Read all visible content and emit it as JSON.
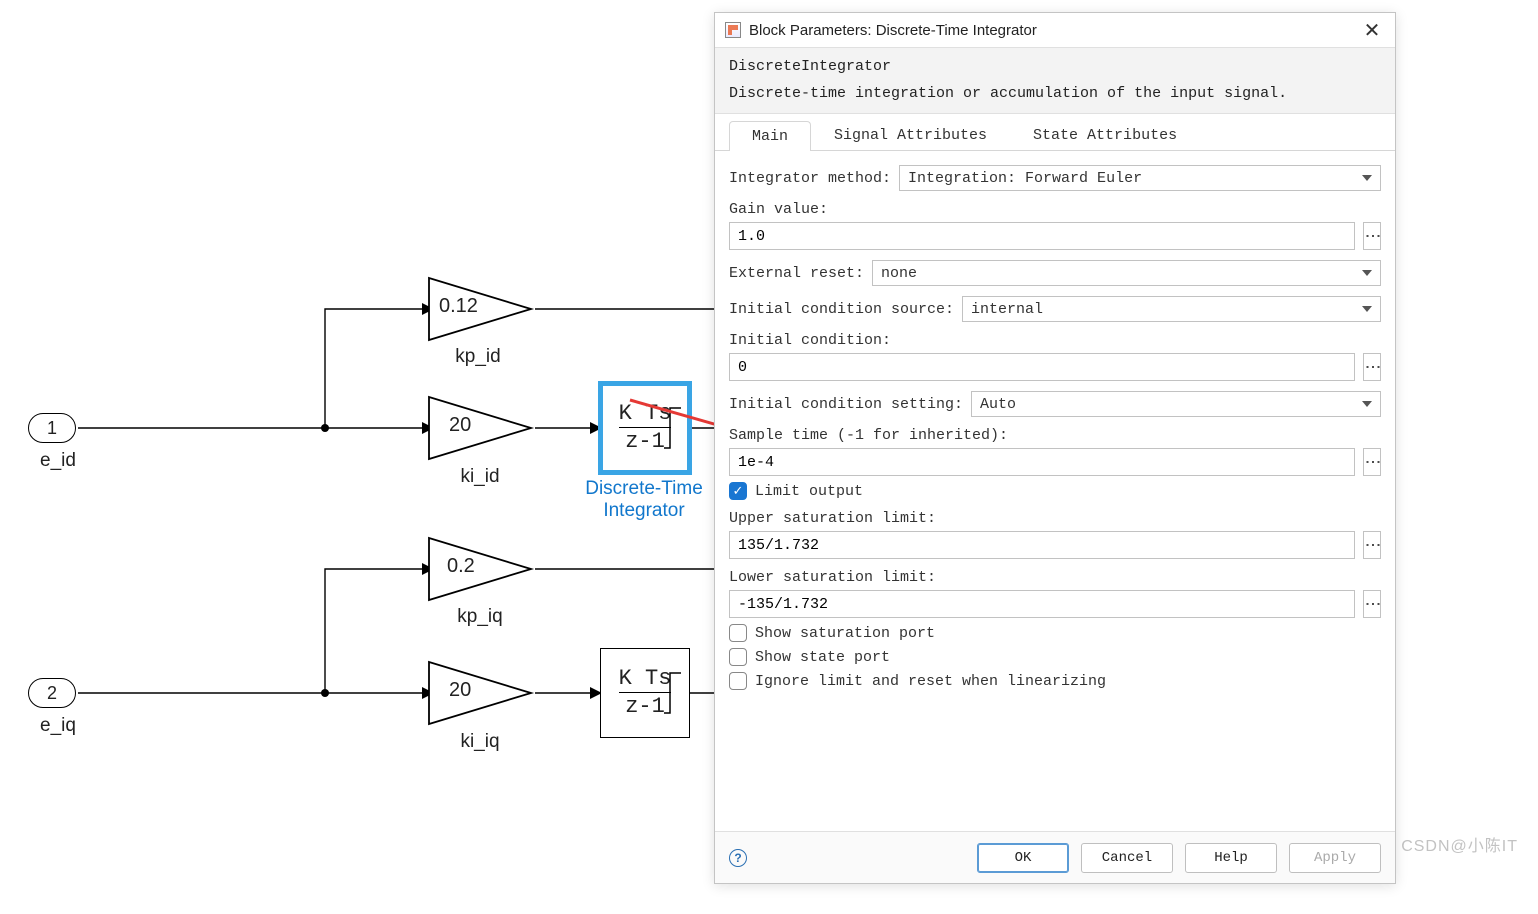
{
  "canvas": {
    "inports": [
      {
        "num": "1",
        "label": "e_id"
      },
      {
        "num": "2",
        "label": "e_iq"
      }
    ],
    "gains": [
      {
        "value": "0.12",
        "label": "kp_id"
      },
      {
        "value": "20",
        "label": "ki_id"
      },
      {
        "value": "0.2",
        "label": "kp_iq"
      },
      {
        "value": "20",
        "label": "ki_iq"
      }
    ],
    "integrators": [
      {
        "num": "K Ts",
        "den": "z-1",
        "label": "Discrete-Time\nIntegrator",
        "selected": true
      },
      {
        "num": "K Ts",
        "den": "z-1",
        "label": "",
        "selected": false
      }
    ]
  },
  "dialog": {
    "title": "Block Parameters: Discrete-Time Integrator",
    "desc_name": "DiscreteIntegrator",
    "desc_text": "Discrete-time integration or accumulation of the input signal.",
    "tabs": [
      "Main",
      "Signal Attributes",
      "State Attributes"
    ],
    "active_tab": 0,
    "labels": {
      "integrator_method": "Integrator method:",
      "gain_value": "Gain value:",
      "external_reset": "External reset:",
      "initial_cond_source": "Initial condition source:",
      "initial_condition": "Initial condition:",
      "initial_cond_setting": "Initial condition setting:",
      "sample_time": "Sample time (-1 for inherited):",
      "limit_output": "Limit output",
      "upper_sat": "Upper saturation limit:",
      "lower_sat": "Lower saturation limit:",
      "show_sat_port": "Show saturation port",
      "show_state_port": "Show state port",
      "ignore_limit": "Ignore limit and reset when linearizing"
    },
    "values": {
      "integrator_method": "Integration: Forward Euler",
      "gain_value": "1.0",
      "external_reset": "none",
      "initial_cond_source": "internal",
      "initial_condition": "0",
      "initial_cond_setting": "Auto",
      "sample_time": "1e-4",
      "upper_sat": "135/1.732",
      "lower_sat": "-135/1.732"
    },
    "checks": {
      "limit_output": true,
      "show_sat_port": false,
      "show_state_port": false,
      "ignore_limit": false
    },
    "buttons": {
      "ok": "OK",
      "cancel": "Cancel",
      "help": "Help",
      "apply": "Apply"
    }
  },
  "watermark": "CSDN@小陈IT"
}
